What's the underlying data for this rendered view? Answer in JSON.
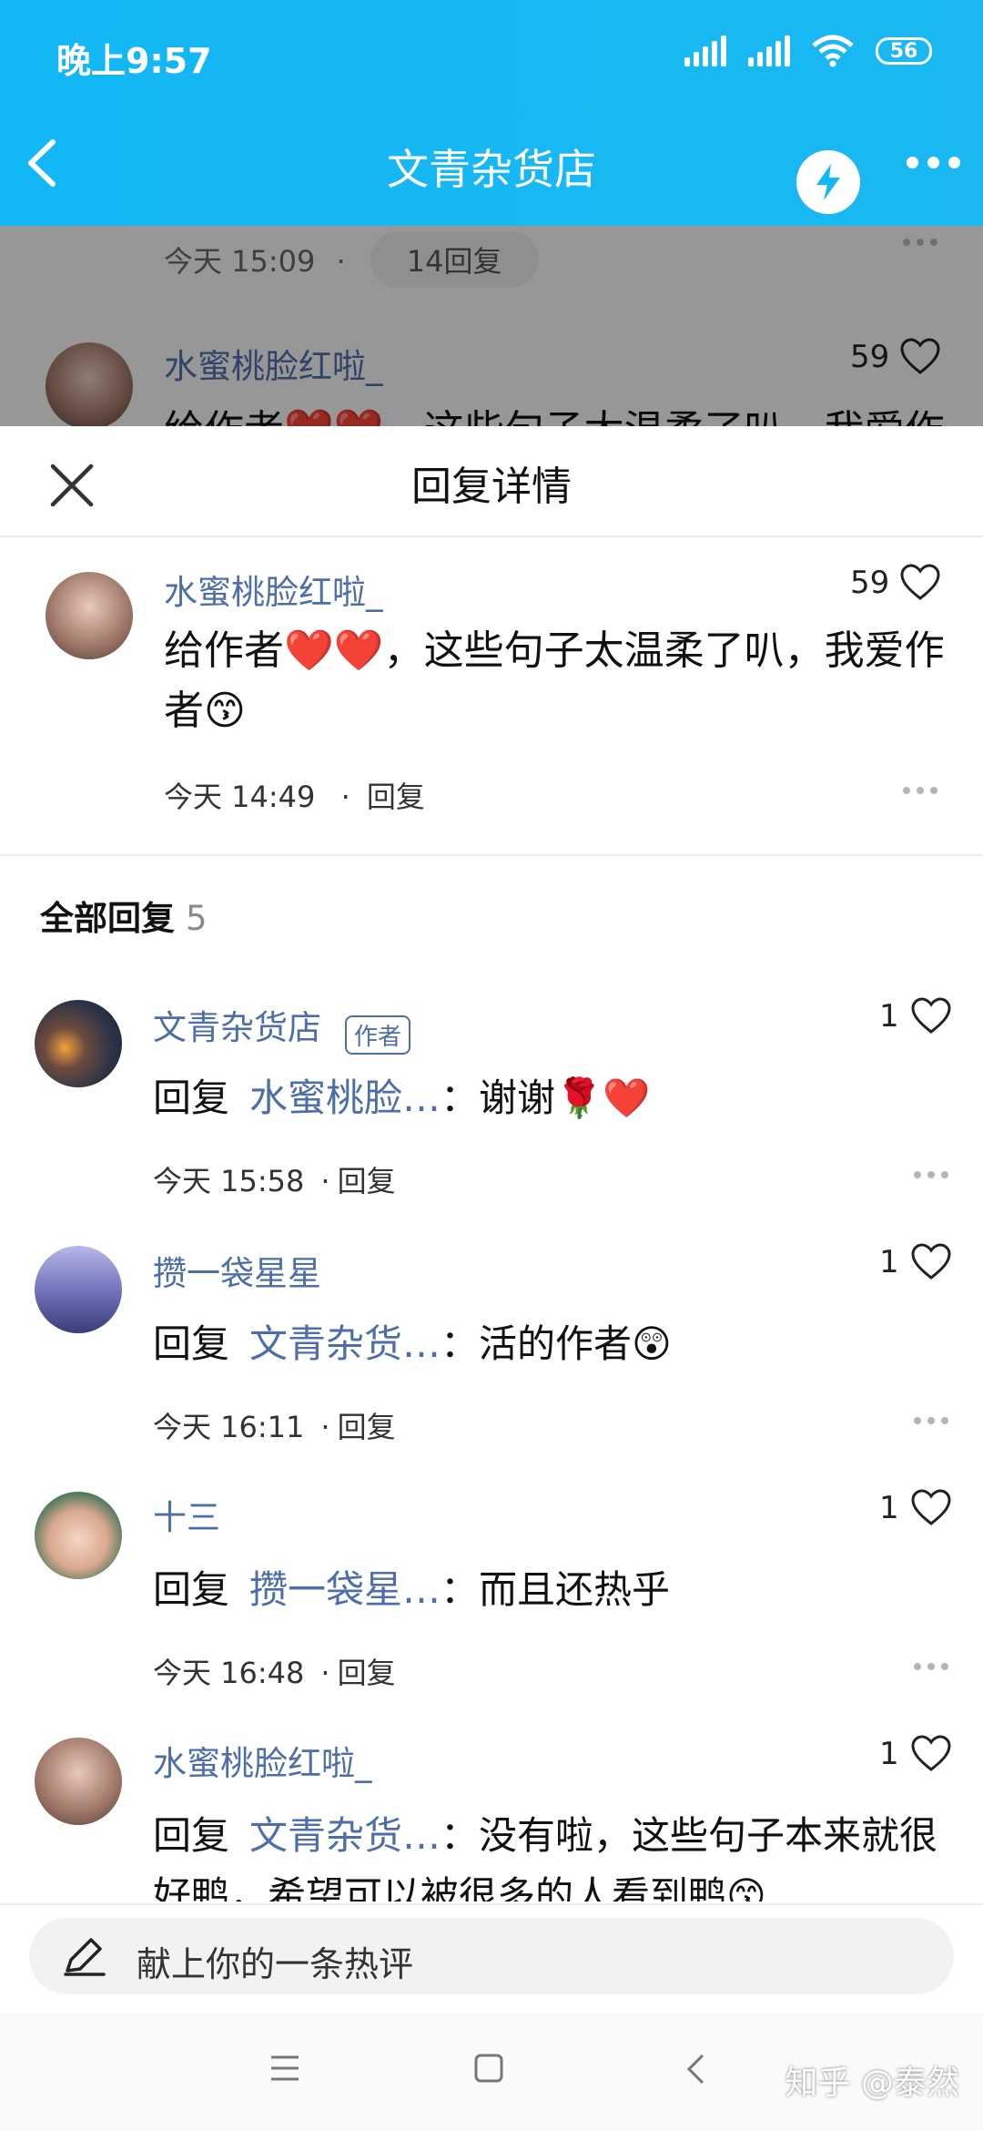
{
  "status_bar": {
    "time": "晚上9:57",
    "battery": "56"
  },
  "header": {
    "title": "文青杂货店"
  },
  "background_thread": {
    "meta_time": "今天 15:09",
    "meta_dot": "·",
    "replies_pill": "14回复",
    "comment_user": "水蜜桃脸红啦_",
    "comment_likes": "59",
    "comment_preview": "给作者❤️❤️，这些句子太温柔了叭，我爱作"
  },
  "sheet": {
    "title": "回复详情",
    "main_comment": {
      "user": "水蜜桃脸红啦_",
      "likes": "59",
      "text": "给作者❤️❤️，这些句子太温柔了叭，我爱作者😙",
      "time": "今天 14:49",
      "reply_label": "回复"
    },
    "section": {
      "label": "全部回复",
      "count": "5"
    },
    "replies": [
      {
        "user": "文青杂货店",
        "tag": "作者",
        "likes": "1",
        "prefix": "回复",
        "to": "水蜜桃脸…",
        "colon": "：",
        "text": "谢谢🌹❤️",
        "time": "今天 15:58",
        "reply_label": "回复"
      },
      {
        "user": "攒一袋星星",
        "tag": "",
        "likes": "1",
        "prefix": "回复",
        "to": "文青杂货…",
        "colon": "：",
        "text": "活的作者😲",
        "time": "今天 16:11",
        "reply_label": "回复"
      },
      {
        "user": "十三",
        "tag": "",
        "likes": "1",
        "prefix": "回复",
        "to": "攒一袋星…",
        "colon": "：",
        "text": "而且还热乎",
        "time": "今天 16:48",
        "reply_label": "回复"
      },
      {
        "user": "水蜜桃脸红啦_",
        "tag": "",
        "likes": "1",
        "prefix": "回复",
        "to": "文青杂货…",
        "colon": "：",
        "text": "没有啦，这些句子本来就很",
        "text2": "好鸭，希望可以被很多的人看到鸭😙"
      }
    ]
  },
  "input": {
    "placeholder": "献上你的一条热评"
  },
  "watermark": "知乎 @泰然",
  "colors": {
    "header_blue": "#12b7f5",
    "link_blue": "#4e6ea8",
    "heart_red": "#e02d2d"
  }
}
